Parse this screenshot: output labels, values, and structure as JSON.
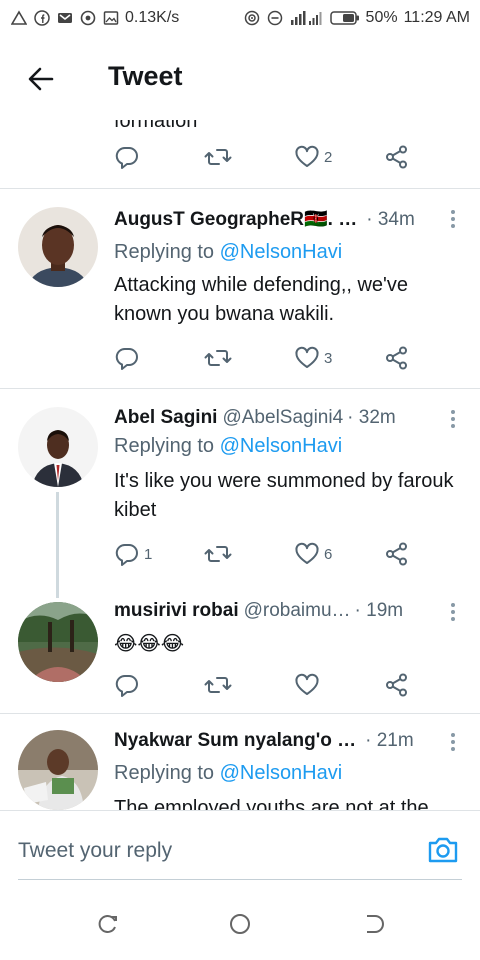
{
  "status_bar": {
    "speed": "0.13K/s",
    "battery": "50%",
    "time": "11:29 AM"
  },
  "app_bar": {
    "title": "Tweet"
  },
  "previous_tweet": {
    "cut_text": "formation",
    "reply_count": "",
    "retweet_count": "",
    "like_count": "2"
  },
  "tweets": [
    {
      "name": "AugusT GeographeR🇰🇪. …",
      "handle": "",
      "time": "· 34m",
      "replying_prefix": "Replying to ",
      "replying_to": "@NelsonHavi",
      "text": "Attacking while defending,, we've known you bwana wakili.",
      "reply_count": "",
      "like_count": "3"
    },
    {
      "name": "Abel Sagini",
      "handle": "@AbelSagini4",
      "time": "· 32m",
      "replying_prefix": "Replying to ",
      "replying_to": "@NelsonHavi",
      "text": "It's like you were summoned by farouk kibet",
      "reply_count": "1",
      "like_count": "6"
    },
    {
      "name": "musirivi robai",
      "handle": "@robaimu…",
      "time": "· 19m",
      "text": "😂😂😂",
      "reply_count": "",
      "like_count": ""
    },
    {
      "name": "Nyakwar Sum nyalang'o …",
      "handle": "",
      "time": "· 21m",
      "replying_prefix": "Replying to ",
      "replying_to": "@NelsonHavi",
      "text": "The employed youths are not at the"
    }
  ],
  "reply_bar": {
    "placeholder": "Tweet your reply"
  },
  "colors": {
    "accent": "#1d9bf0",
    "secondary_text": "#536471"
  }
}
